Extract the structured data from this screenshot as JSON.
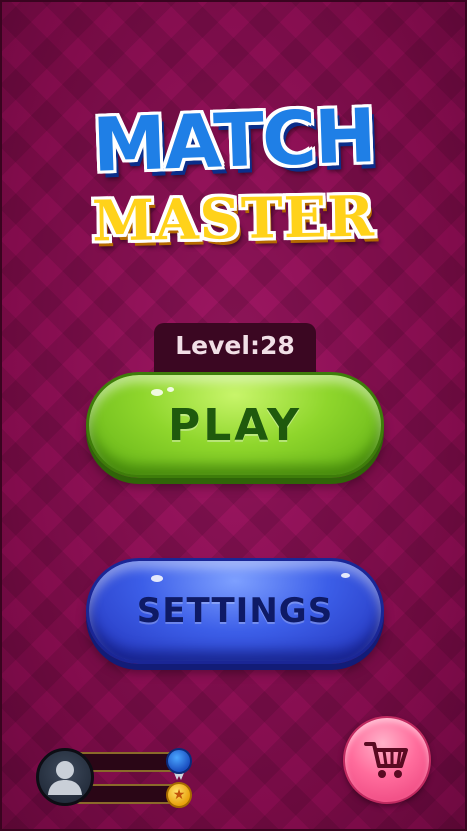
{
  "logo": {
    "line1": "MATCH",
    "line2": "MASTER"
  },
  "level": {
    "label": "Level:28"
  },
  "buttons": {
    "play_label": "PLAY",
    "settings_label": "SETTINGS"
  },
  "icons": {
    "avatar": "user-silhouette-icon",
    "rank_medal": "blue-medal-icon",
    "star_medal": "gold-star-medal-icon",
    "shop": "shopping-cart-icon"
  },
  "colors": {
    "background": "#8a0f52",
    "play_button": "#8fd62c",
    "settings_button": "#3c5ee8",
    "cart_button": "#ff6c9c",
    "logo_blue": "#1f7fe6",
    "logo_yellow": "#ffd21a"
  }
}
